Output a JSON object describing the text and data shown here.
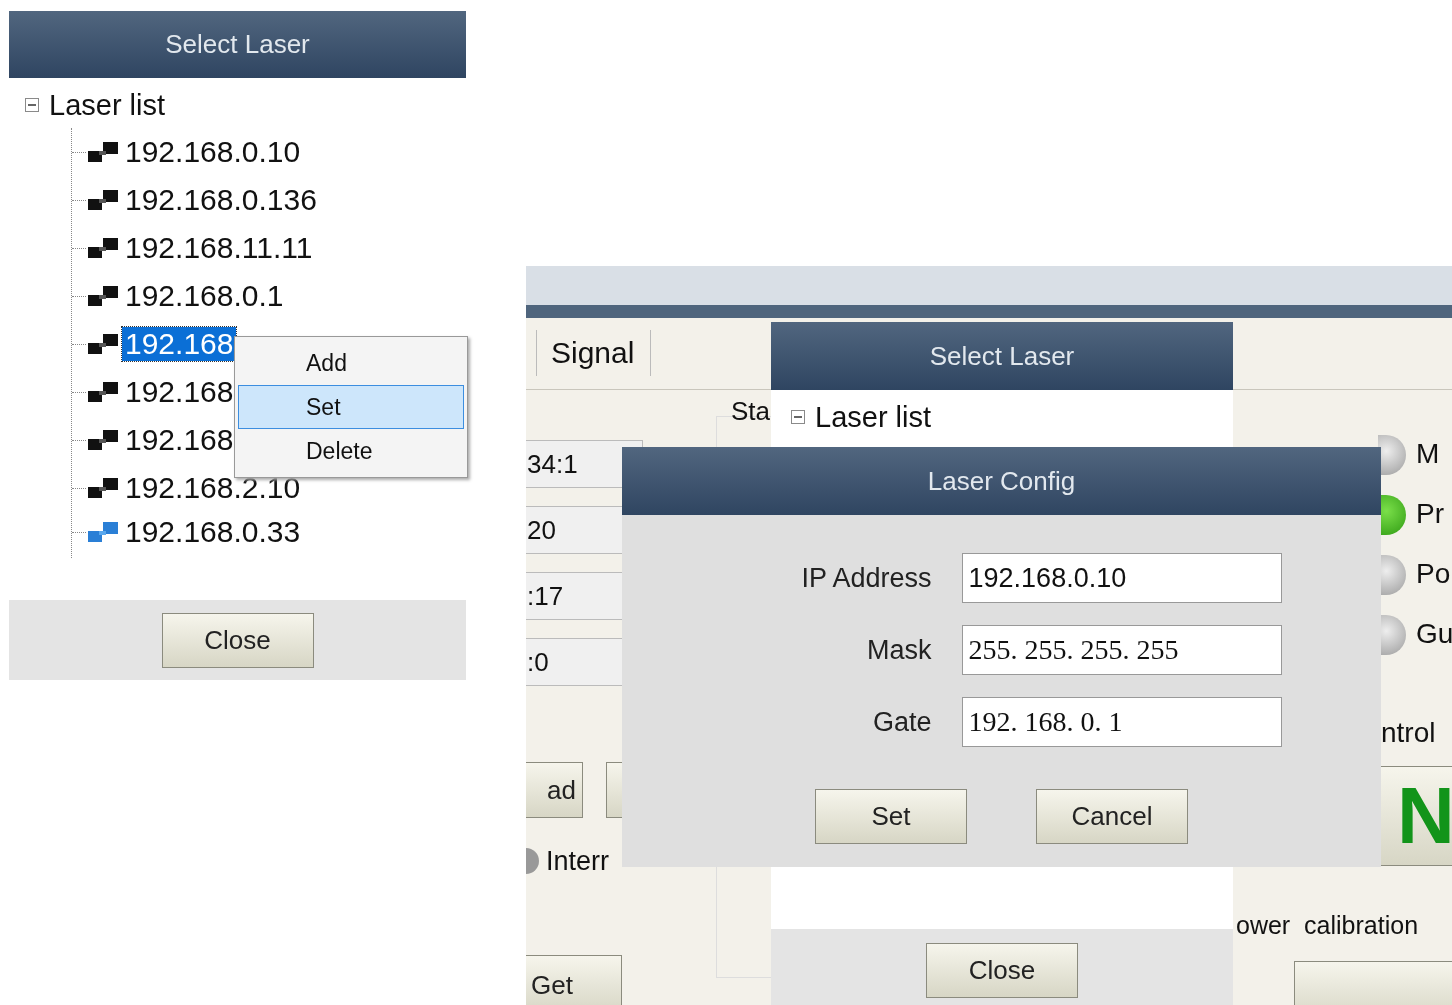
{
  "left_panel": {
    "title": "Select Laser",
    "tree": {
      "label": "Laser list",
      "expanded": true,
      "children": [
        {
          "label": "192.168.0.10",
          "selected": false,
          "active": false
        },
        {
          "label": "192.168.0.136",
          "selected": false,
          "active": false
        },
        {
          "label": "192.168.11.11",
          "selected": false,
          "active": false
        },
        {
          "label": "192.168.0.1",
          "selected": false,
          "active": false
        },
        {
          "label": "192.168",
          "selected": true,
          "active": false
        },
        {
          "label": "192.168",
          "selected": false,
          "active": false
        },
        {
          "label": "192.168",
          "selected": false,
          "active": false
        },
        {
          "label": "192.168.2.10",
          "selected": false,
          "active": false
        },
        {
          "label": "192.168.0.33",
          "selected": false,
          "active": true
        }
      ]
    },
    "context_menu": [
      {
        "label": "Add",
        "selected": false
      },
      {
        "label": "Set",
        "selected": true
      },
      {
        "label": "Delete",
        "selected": false
      }
    ],
    "close_button": "Close"
  },
  "right_panel": {
    "background": {
      "tab": "Signal",
      "group_label": "Sta",
      "values": [
        "34:1",
        "20",
        ":17",
        ":0"
      ],
      "buttons": [
        "ad",
        "Get"
      ],
      "radio_label": "Interr",
      "indicators": [
        {
          "label": "M",
          "on": false
        },
        {
          "label": "Pr",
          "on": true
        },
        {
          "label": "Po",
          "on": false
        },
        {
          "label": "Gu",
          "on": false
        }
      ],
      "control_label": "ntrol",
      "on_button": "N",
      "calibration_label": "ower  calibration"
    },
    "select_laser": {
      "title": "Select Laser",
      "tree_root": "Laser list",
      "expanded": true,
      "close_button": "Close"
    },
    "laser_config": {
      "title": "Laser Config",
      "fields": [
        {
          "label": "IP Address",
          "value": "192.168.0.10",
          "mono": false
        },
        {
          "label": "Mask",
          "value": "255. 255. 255. 255",
          "mono": true
        },
        {
          "label": "Gate",
          "value": "192. 168. 0. 1",
          "mono": true
        }
      ],
      "buttons": [
        "Set",
        "Cancel"
      ]
    }
  }
}
